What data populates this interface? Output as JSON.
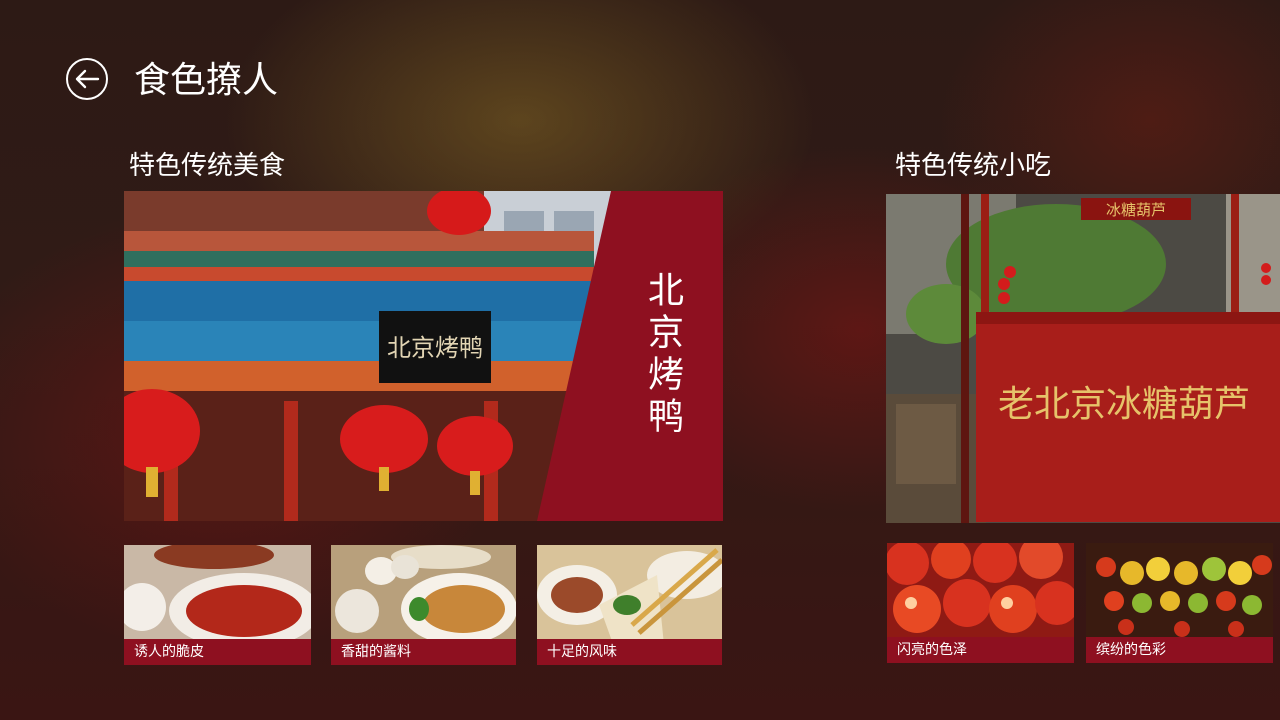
{
  "header": {
    "title": "食色撩人",
    "back_icon": "back-arrow-icon"
  },
  "sections": [
    {
      "title": "特色传统美食",
      "hero": {
        "overlay_text": "北京烤鸭",
        "sign_text": "北京烤鸭",
        "accent": "#8e1020"
      },
      "tiles": [
        {
          "caption": "诱人的脆皮"
        },
        {
          "caption": "香甜的酱料"
        },
        {
          "caption": "十足的风味"
        }
      ]
    },
    {
      "title": "特色传统小吃",
      "hero": {
        "sign_small": "冰糖葫芦",
        "sign_big": "老北京冰糖葫芦"
      },
      "tiles": [
        {
          "caption": "闪亮的色泽"
        },
        {
          "caption": "缤纷的色彩"
        }
      ]
    }
  ],
  "colors": {
    "caption_bg": "#8e1020",
    "text": "#ffffff"
  }
}
